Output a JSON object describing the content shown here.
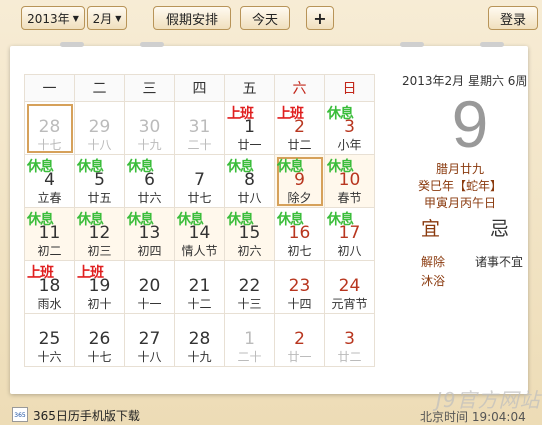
{
  "toolbar": {
    "year": "2013年",
    "month": "2月",
    "holiday_btn": "假期安排",
    "today_btn": "今天",
    "add_btn": "+",
    "login_btn": "登录"
  },
  "weekdays": [
    "一",
    "二",
    "三",
    "四",
    "五",
    "六",
    "日"
  ],
  "weeks": [
    [
      {
        "d": "28",
        "l": "十七",
        "other": true,
        "today": true
      },
      {
        "d": "29",
        "l": "十八",
        "other": true
      },
      {
        "d": "30",
        "l": "十九",
        "other": true
      },
      {
        "d": "31",
        "l": "二十",
        "other": true
      },
      {
        "d": "1",
        "l": "廿一",
        "tag": "上班"
      },
      {
        "d": "2",
        "l": "廿二",
        "tag": "上班"
      },
      {
        "d": "3",
        "l": "小年",
        "tag": "休息"
      }
    ],
    [
      {
        "d": "4",
        "l": "立春",
        "tag": "休息"
      },
      {
        "d": "5",
        "l": "廿五",
        "tag": "休息"
      },
      {
        "d": "6",
        "l": "廿六",
        "tag": "休息"
      },
      {
        "d": "7",
        "l": "廿七"
      },
      {
        "d": "8",
        "l": "廿八",
        "tag": "休息"
      },
      {
        "d": "9",
        "l": "除夕",
        "tag": "休息",
        "hol": true,
        "sel": true
      },
      {
        "d": "10",
        "l": "春节",
        "tag": "休息",
        "hol": true
      }
    ],
    [
      {
        "d": "11",
        "l": "初二",
        "tag": "休息",
        "hol": true
      },
      {
        "d": "12",
        "l": "初三",
        "tag": "休息",
        "hol": true
      },
      {
        "d": "13",
        "l": "初四",
        "tag": "休息",
        "hol": true
      },
      {
        "d": "14",
        "l": "情人节",
        "tag": "休息",
        "hol": true
      },
      {
        "d": "15",
        "l": "初六",
        "tag": "休息",
        "hol": true
      },
      {
        "d": "16",
        "l": "初七",
        "tag": "休息"
      },
      {
        "d": "17",
        "l": "初八",
        "tag": "休息"
      }
    ],
    [
      {
        "d": "18",
        "l": "雨水",
        "tag": "上班"
      },
      {
        "d": "19",
        "l": "初十",
        "tag": "上班"
      },
      {
        "d": "20",
        "l": "十一"
      },
      {
        "d": "21",
        "l": "十二"
      },
      {
        "d": "22",
        "l": "十三"
      },
      {
        "d": "23",
        "l": "十四"
      },
      {
        "d": "24",
        "l": "元宵节"
      }
    ],
    [
      {
        "d": "25",
        "l": "十六"
      },
      {
        "d": "26",
        "l": "十七"
      },
      {
        "d": "27",
        "l": "十八"
      },
      {
        "d": "28",
        "l": "十九"
      },
      {
        "d": "1",
        "l": "二十",
        "other": true
      },
      {
        "d": "2",
        "l": "廿一",
        "other": true
      },
      {
        "d": "3",
        "l": "廿二",
        "other": true
      }
    ]
  ],
  "detail": {
    "header": "2013年2月  星期六  6周",
    "big_day": "9",
    "lunar": "腊月廿九",
    "ganzhi_year": "癸巳年【蛇年】",
    "ganzhi_month": "甲寅月丙午日",
    "yi_label": "宜",
    "ji_label": "忌",
    "yi_items": [
      "解除",
      "沐浴"
    ],
    "ji_items": [
      "诸事不宜"
    ]
  },
  "footer": {
    "app_icon": "365",
    "download_link": "365日历手机版下载",
    "beijing_time": "北京时间  19:04:04",
    "watermark": "J9官方网站"
  },
  "colors": {
    "rest_tag": "#3bbd3b",
    "work_tag": "#e02020",
    "accent": "#d6a15a",
    "weekend": "#c2261a"
  }
}
